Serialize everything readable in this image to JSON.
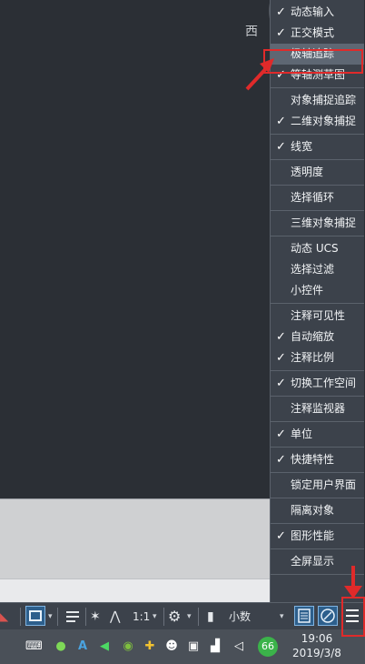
{
  "compass": {
    "label": "西"
  },
  "menu": {
    "groups": [
      [
        {
          "label": "动态输入",
          "checked": true
        },
        {
          "label": "正交模式",
          "checked": true
        },
        {
          "label": "极轴追踪",
          "checked": false,
          "highlight": true
        },
        {
          "label": "等轴测草图",
          "checked": true
        }
      ],
      [
        {
          "label": "对象捕捉追踪",
          "checked": false
        },
        {
          "label": "二维对象捕捉",
          "checked": true
        }
      ],
      [
        {
          "label": "线宽",
          "checked": true
        }
      ],
      [
        {
          "label": "透明度",
          "checked": false
        }
      ],
      [
        {
          "label": "选择循环",
          "checked": false
        }
      ],
      [
        {
          "label": "三维对象捕捉",
          "checked": false
        }
      ],
      [
        {
          "label": "动态 UCS",
          "checked": false
        },
        {
          "label": "选择过滤",
          "checked": false
        },
        {
          "label": "小控件",
          "checked": false
        }
      ],
      [
        {
          "label": "注释可见性",
          "checked": false
        },
        {
          "label": "自动缩放",
          "checked": true
        },
        {
          "label": "注释比例",
          "checked": true
        }
      ],
      [
        {
          "label": "切换工作空间",
          "checked": true
        }
      ],
      [
        {
          "label": "注释监视器",
          "checked": false
        }
      ],
      [
        {
          "label": "单位",
          "checked": true
        }
      ],
      [
        {
          "label": "快捷特性",
          "checked": true
        }
      ],
      [
        {
          "label": "锁定用户界面",
          "checked": false
        }
      ],
      [
        {
          "label": "隔离对象",
          "checked": false
        }
      ],
      [
        {
          "label": "图形性能",
          "checked": true
        }
      ],
      [
        {
          "label": "全屏显示",
          "checked": false
        }
      ]
    ],
    "check_glyph": "✓"
  },
  "statusbar": {
    "scale": "1:1",
    "units": "小数",
    "dropdown_glyph": "▾"
  },
  "taskbar": {
    "badge": "66",
    "time": "19:06",
    "date": "2019/3/8"
  },
  "colors": {
    "annotation_red": "#e02a2a",
    "menu_bg": "#3c424b",
    "highlight": "#5e6773"
  }
}
